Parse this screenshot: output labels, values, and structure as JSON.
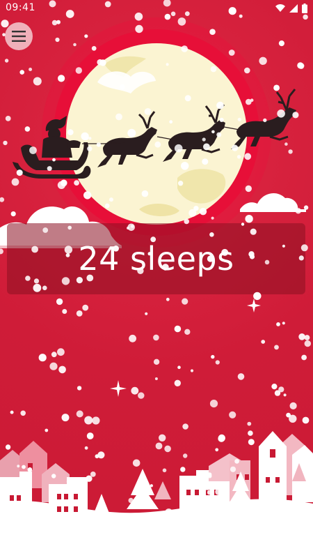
{
  "status_bar": {
    "time": "09:41",
    "icons": [
      "wifi-icon",
      "cellular-signal-icon",
      "battery-icon"
    ]
  },
  "menu": {
    "icon": "hamburger-menu-icon"
  },
  "countdown": {
    "text": "24 sleeps"
  },
  "scene": {
    "elements": [
      "moon",
      "santa-sleigh-silhouette",
      "reindeer-silhouettes",
      "clouds",
      "snowfall",
      "snowy-village"
    ]
  },
  "colors": {
    "background": "#d31f3c",
    "moon": "#fbf4d2",
    "moon_glow": "#e7113a",
    "silhouette": "#2a1d1f",
    "banner": "#8c1023",
    "snow": "#ffffff"
  }
}
